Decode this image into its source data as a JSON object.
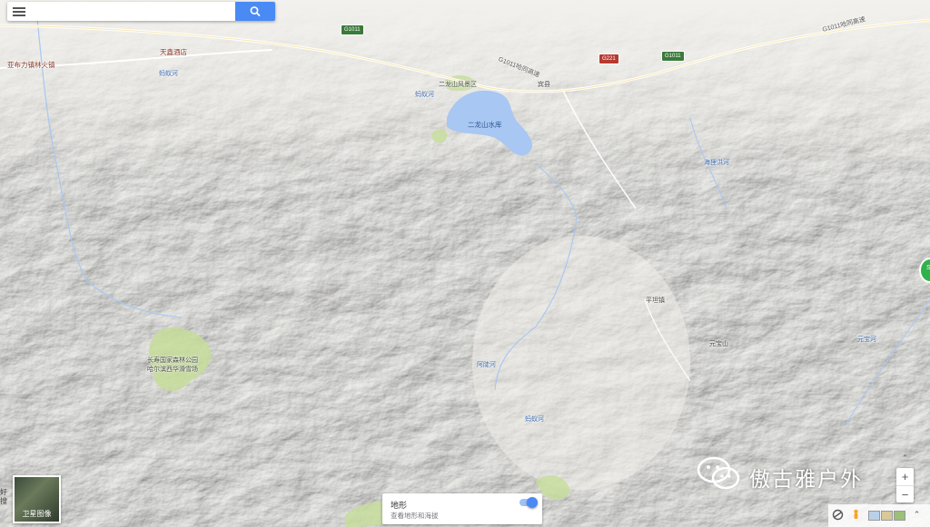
{
  "search": {
    "placeholder": "",
    "value": ""
  },
  "icons": {
    "menu": "menu-icon",
    "search": "search-icon"
  },
  "places": [
    {
      "text": "G1011",
      "kind": "shield"
    },
    {
      "text": "G1011",
      "kind": "shield"
    },
    {
      "text": "G221",
      "kind": "shield-red"
    },
    {
      "text": "G1011哈同高速",
      "kind": "road"
    },
    {
      "text": "G1011哈同高速",
      "kind": "road"
    },
    {
      "text": "天鑫酒店",
      "kind": "poi"
    },
    {
      "text": "亚布力镇林火镇",
      "kind": "poi"
    },
    {
      "text": "蚂蚁河",
      "kind": "water"
    },
    {
      "text": "二龙山风景区",
      "kind": "place"
    },
    {
      "text": "蚂蚁河",
      "kind": "water"
    },
    {
      "text": "二龙山水库",
      "kind": "lake"
    },
    {
      "text": "宾县",
      "kind": "place"
    },
    {
      "text": "海狸洪河",
      "kind": "water"
    },
    {
      "text": "长寿国家森林公园",
      "kind": "place"
    },
    {
      "text": "哈尔滨西华滑雪场",
      "kind": "place"
    },
    {
      "text": "阿陡河",
      "kind": "water"
    },
    {
      "text": "蚂蚁河",
      "kind": "water"
    },
    {
      "text": "元宝山",
      "kind": "place"
    },
    {
      "text": "元宝河",
      "kind": "water"
    },
    {
      "text": "平坦镇",
      "kind": "place"
    }
  ],
  "satellite": {
    "label": "卫星图像"
  },
  "side_text": "好搜",
  "terrain": {
    "title": "地形",
    "subtitle": "查看地形和海拔",
    "enabled": true
  },
  "zoom": {
    "in": "+",
    "out": "−",
    "expand": "⌃"
  },
  "watermark": {
    "text": "傲古雅户外"
  },
  "marker": {
    "label": "S"
  },
  "colors": {
    "accent": "#4a8af4",
    "lake": "#a8c7f2",
    "park": "#c5dd9a",
    "highway": "#ffffff"
  }
}
